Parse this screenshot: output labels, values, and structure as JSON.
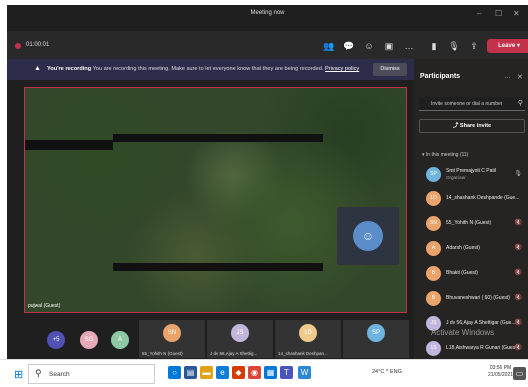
{
  "window": {
    "title": "Meeting now",
    "minimize": "–",
    "maximize": "☐",
    "close": "✕"
  },
  "callbar": {
    "timer": "01:00:01",
    "leave_label": "Leave",
    "more": "…"
  },
  "banner": {
    "warn_icon": "▲",
    "bold": "You're recording",
    "text": "You are recording this meeting. Make sure to let everyone know that they are being recorded.",
    "link": "Privacy policy",
    "dismiss": "Dismiss"
  },
  "video": {
    "presenter_label": "pujwal (Guest)",
    "avatar_icon": "☺"
  },
  "tiles": {
    "avatars": [
      {
        "initials": "+5",
        "color": "#4f52b2"
      },
      {
        "initials": "SG",
        "color": "#e8a9b6"
      },
      {
        "initials": "A",
        "color": "#8fc9a3"
      }
    ],
    "video_tiles": [
      {
        "initials": "SN",
        "color": "#e9a36b",
        "label": "55_Yohith N (Guest)"
      },
      {
        "initials": "JS",
        "color": "#c3b6dc",
        "label": "J dv 56,Ajay A Shettig..."
      },
      {
        "initials": "1D",
        "color": "#f0c98c",
        "label": "14_shashank Deshpan..."
      },
      {
        "initials": "SP",
        "color": "#6fb3df",
        "label": ""
      }
    ]
  },
  "panel": {
    "title": "Participants",
    "search_placeholder": "Invite someone or dial a number",
    "share_invite": "Share invite",
    "in_meeting": "In this meeting (11)",
    "people": [
      {
        "initials": "SP",
        "name": "Smt Premajyoti C Patil",
        "role": "Organiser",
        "color": "#6fb3df"
      },
      {
        "initials": "1D",
        "name": "14_shashank Deshpande (Gue...",
        "role": "",
        "color": "#e9a36b"
      },
      {
        "initials": "SN",
        "name": "55_Yohith N (Guest)",
        "role": "",
        "color": "#e9a36b"
      },
      {
        "initials": "A",
        "name": "Adarsh (Guest)",
        "role": "",
        "color": "#e9a36b"
      },
      {
        "initials": "B",
        "name": "Bhakti (Guest)",
        "role": "",
        "color": "#e9a36b"
      },
      {
        "initials": "B",
        "name": "Bhuvaneshwari ( 60) (Guest)",
        "role": "",
        "color": "#e9a36b"
      },
      {
        "initials": "JS",
        "name": "J dv 56,Ajay A Shettigar (Gue...",
        "role": "",
        "color": "#c3b6dc"
      },
      {
        "initials": "1S",
        "name": "L18,Aishwarya R Gunari (Guest)",
        "role": "",
        "color": "#c3b6dc"
      }
    ]
  },
  "watermark": "Activate Windows",
  "taskbar": {
    "search": "Search",
    "tray": "24°C  ^  ENG",
    "time": "03:56 PM",
    "date": "21/05/2021"
  }
}
